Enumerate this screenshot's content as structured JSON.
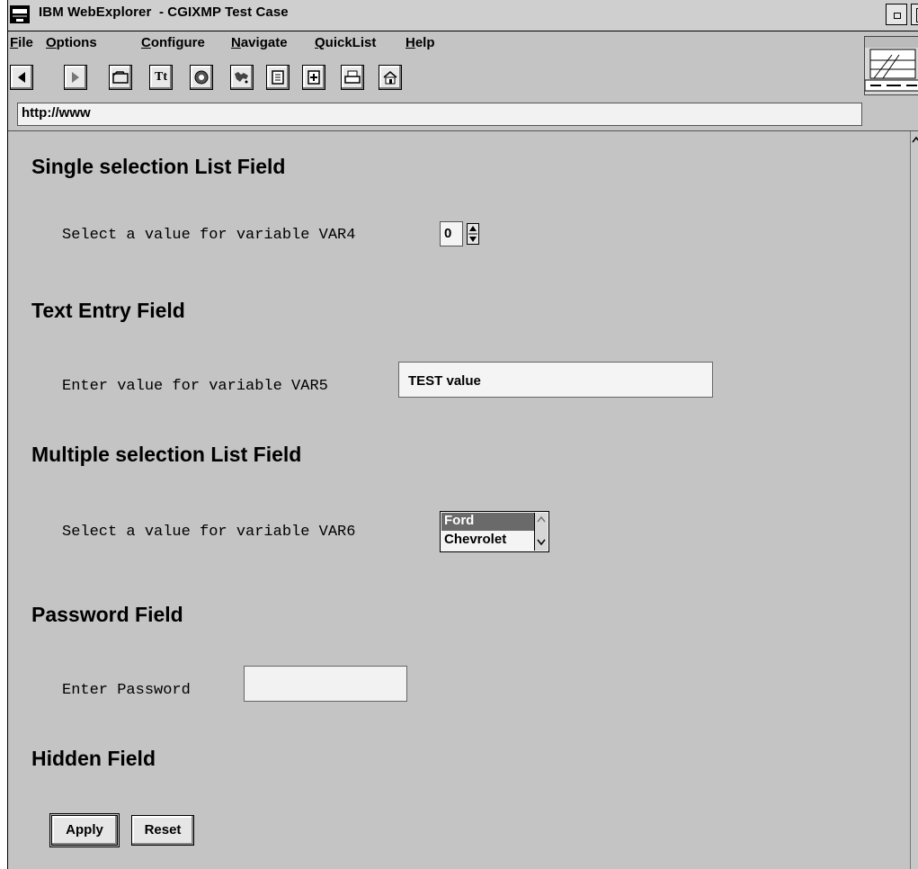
{
  "window": {
    "title": "IBM WebExplorer  - CGIXMP Test Case"
  },
  "menu": [
    {
      "key": "F",
      "rest": "ile"
    },
    {
      "key": "O",
      "rest": "ptions"
    },
    {
      "key": "C",
      "rest": "onfigure"
    },
    {
      "key": "N",
      "rest": "avigate"
    },
    {
      "key": "Q",
      "rest": "uickList"
    },
    {
      "key": "H",
      "rest": "elp"
    }
  ],
  "toolbar": {
    "icons": [
      "back-icon",
      "forward-icon",
      "open-folder-icon",
      "font-icon",
      "stop-icon",
      "world-map-icon",
      "document-icon",
      "add-document-icon",
      "print-icon",
      "home-icon"
    ],
    "font_label": "Tt"
  },
  "url": {
    "value": "http://www"
  },
  "sections": {
    "single": {
      "heading": "Single selection List Field",
      "label": "Select a value for variable VAR4",
      "value": "0"
    },
    "text": {
      "heading": "Text Entry Field",
      "label": "Enter value for variable VAR5",
      "value": "TEST value"
    },
    "multi": {
      "heading": "Multiple selection List Field",
      "label": "Select a value for variable VAR6",
      "options": [
        "Ford",
        "Chevrolet"
      ],
      "selected": "Ford"
    },
    "password": {
      "heading": "Password Field",
      "label": "Enter Password",
      "value": ""
    },
    "hidden": {
      "heading": "Hidden Field"
    }
  },
  "buttons": {
    "apply": "Apply",
    "reset": "Reset"
  }
}
